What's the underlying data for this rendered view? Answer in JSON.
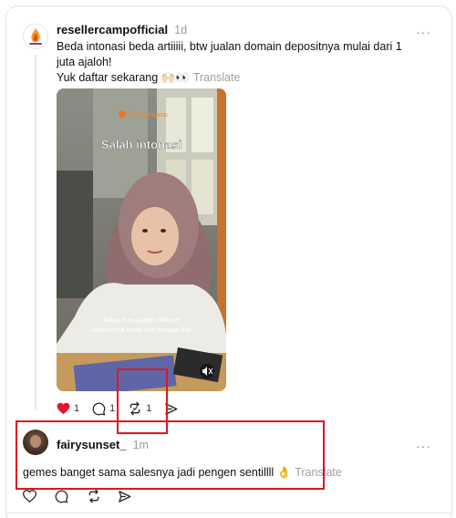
{
  "post": {
    "username": "resellercampofficial",
    "time": "1d",
    "text_line1": "Beda intonasi beda artiiiii, btw jualan domain depositnya mulai dari 1",
    "text_line2": "juta ajaloh!",
    "text_line3": "Yuk daftar sekarang 🙌🏻👀",
    "translate_label": "Translate",
    "more_label": "···",
    "media": {
      "brand_caption": "Resellercamp",
      "overlay_title": "Salah intonasi",
      "subtitle_line1": "kalau mau jualan domain",
      "subtitle_line2": "depositnya mulai dari berapa kak",
      "mute_icon": "speaker-muted-icon"
    },
    "likes_count": "1",
    "replies_count": "1",
    "reposts_count": "1",
    "liked": true,
    "like_color": "#e0162b"
  },
  "reply": {
    "username": "fairysunset_",
    "time": "1m",
    "text": "gemes banget sama salesnya jadi pengen sentillll 👌",
    "translate_label": "Translate",
    "more_label": "···"
  },
  "highlight_color": "#e0161e"
}
